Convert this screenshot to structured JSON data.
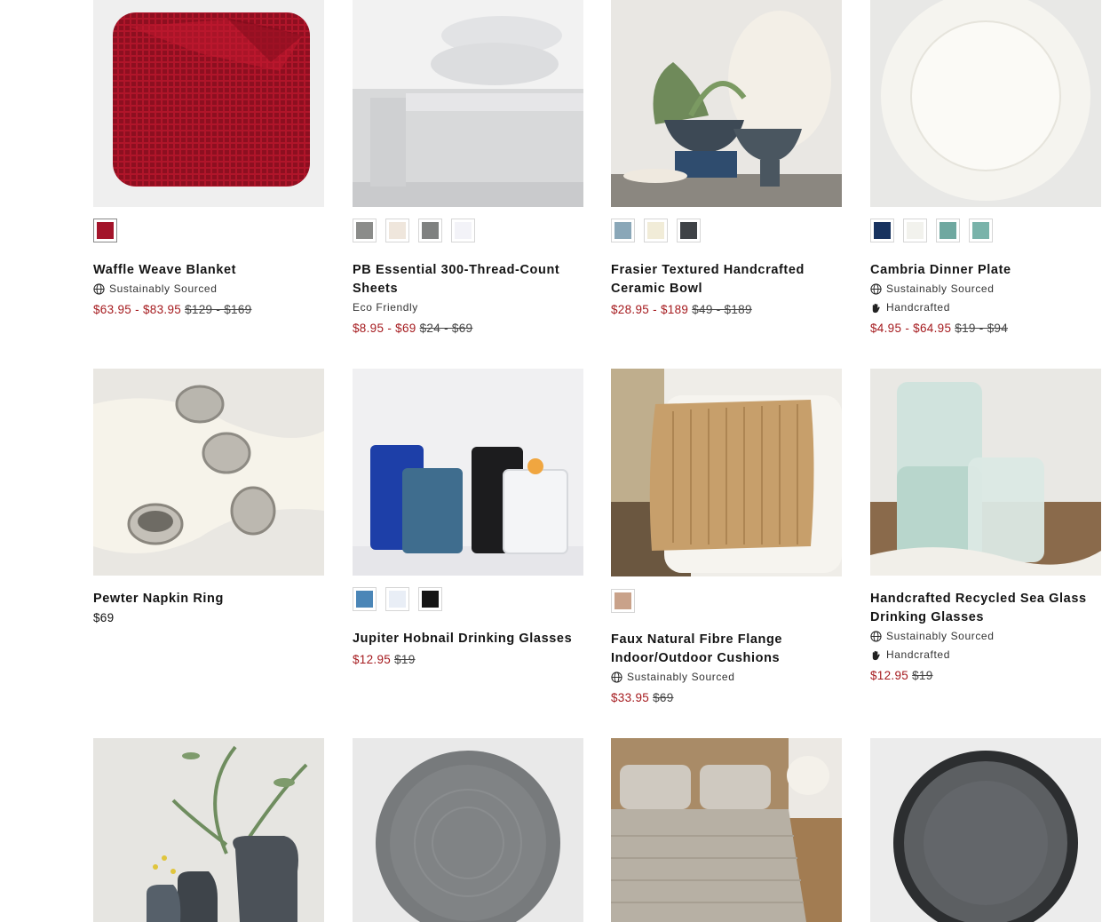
{
  "products": [
    {
      "title": "Waffle Weave Blanket",
      "badges": [
        "Sustainably Sourced"
      ],
      "sale_price": "$63.95 - $83.95",
      "was_price": "$129 - $169",
      "swatch_colors": [
        "#a3142a"
      ]
    },
    {
      "title": "PB Essential 300-Thread-Count Sheets",
      "badges": [
        "Eco Friendly"
      ],
      "sale_price": "$8.95 - $69",
      "was_price": "$24 - $69",
      "swatch_colors": [
        "#8b8c8a",
        "#efe6dc",
        "#7f8180",
        "#f3f3f8"
      ]
    },
    {
      "title": "Frasier Textured Handcrafted Ceramic Bowl",
      "badges": [],
      "sale_price": "$28.95 - $189",
      "was_price": "$49 - $189",
      "swatch_colors": [
        "#8aa7b8",
        "#f1ecd8",
        "#3e4246"
      ]
    },
    {
      "title": "Cambria Dinner Plate",
      "badges": [
        "Sustainably Sourced",
        "Handcrafted"
      ],
      "sale_price": "$4.95 - $64.95",
      "was_price": "$19 - $94",
      "swatch_colors": [
        "#17325f",
        "#f2f2ed",
        "#6fa8a0",
        "#79b3aa"
      ]
    },
    {
      "title": "Pewter Napkin Ring",
      "badges": [],
      "price": "$69",
      "swatch_colors": []
    },
    {
      "title": "Jupiter Hobnail Drinking Glasses",
      "badges": [],
      "sale_price": "$12.95",
      "was_price": "$19",
      "swatch_colors": [
        "#4b86b7",
        "#e9eef6",
        "#151515"
      ]
    },
    {
      "title": "Faux Natural Fibre Flange Indoor/Outdoor Cushions",
      "badges": [
        "Sustainably Sourced"
      ],
      "sale_price": "$33.95",
      "was_price": "$69",
      "swatch_colors": [
        "#c9a28a"
      ]
    },
    {
      "title": "Handcrafted Recycled Sea Glass Drinking Glasses",
      "badges": [
        "Sustainably Sourced",
        "Handcrafted"
      ],
      "sale_price": "$12.95",
      "was_price": "$19",
      "swatch_colors": []
    }
  ],
  "icons": {
    "sustainably_sourced": "globe-icon",
    "handcrafted": "hand-icon"
  }
}
